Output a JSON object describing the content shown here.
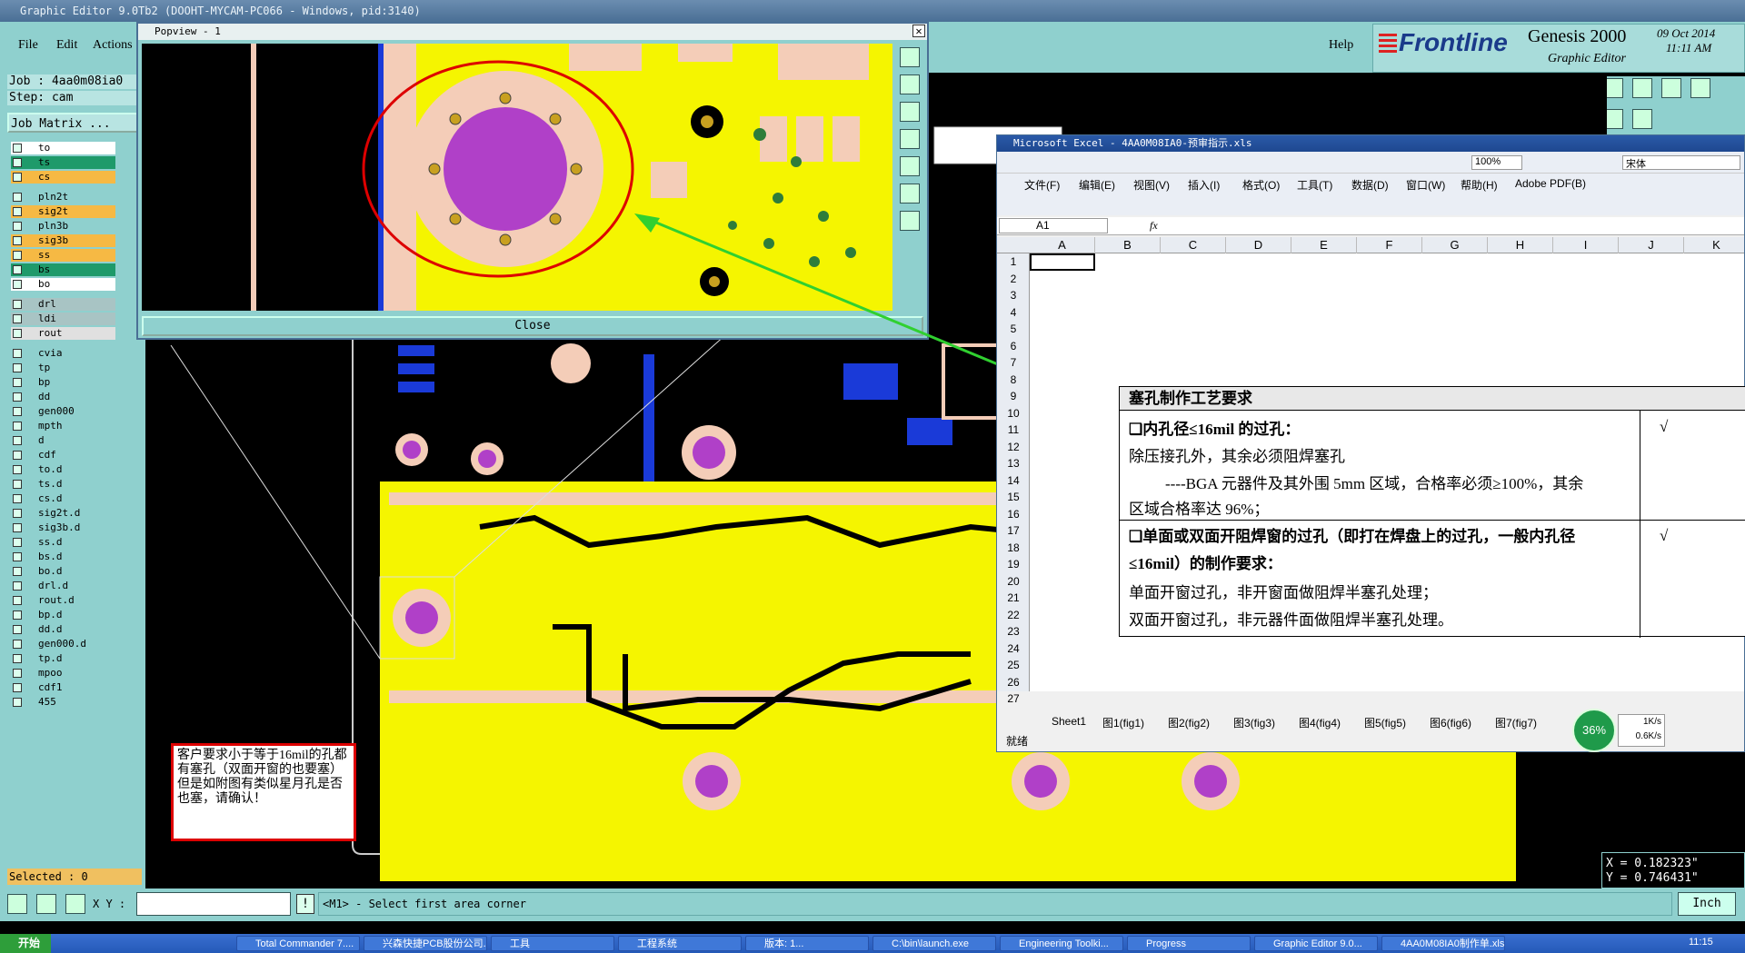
{
  "app": {
    "title": "Graphic Editor 9.0Tb2 (DOOHT-MYCAM-PC066 - Windows, pid:3140)"
  },
  "menu": {
    "file": "File",
    "edit": "Edit",
    "actions": "Actions",
    "help": "Help"
  },
  "brand": {
    "logo": "Frontline",
    "product": "Genesis 2000",
    "subtitle": "Graphic Editor",
    "date": "09 Oct 2014",
    "time": "11:11 AM"
  },
  "job": {
    "job_line": "Job : 4aa0m08ia0",
    "step_line": "Step: cam",
    "matrix_button": "Job Matrix ..."
  },
  "layers": [
    {
      "name": "to",
      "color": "#ffffff"
    },
    {
      "name": "ts",
      "color": "#1e9a6a"
    },
    {
      "name": "cs",
      "color": "#f6b944"
    },
    {
      "name": "pln2t",
      "color": "#8fd0ce"
    },
    {
      "name": "sig2t",
      "color": "#f6b944"
    },
    {
      "name": "pln3b",
      "color": "#8fd0ce"
    },
    {
      "name": "sig3b",
      "color": "#f6b944"
    },
    {
      "name": "ss",
      "color": "#f6b944"
    },
    {
      "name": "bs",
      "color": "#1e9a6a"
    },
    {
      "name": "bo",
      "color": "#ffffff"
    },
    {
      "name": "drl",
      "color": "#a8c4c4"
    },
    {
      "name": "ldi",
      "color": "#a8c4c4"
    },
    {
      "name": "rout",
      "color": "#e0e0e0"
    },
    {
      "name": "cvia",
      "color": "#8fd0ce"
    },
    {
      "name": "tp",
      "color": "#8fd0ce"
    },
    {
      "name": "bp",
      "color": "#8fd0ce"
    },
    {
      "name": "dd",
      "color": "#8fd0ce"
    },
    {
      "name": "gen000",
      "color": "#8fd0ce"
    },
    {
      "name": "mpth",
      "color": "#8fd0ce"
    },
    {
      "name": "d",
      "color": "#8fd0ce"
    },
    {
      "name": "cdf",
      "color": "#8fd0ce"
    },
    {
      "name": "to.d",
      "color": "#8fd0ce"
    },
    {
      "name": "ts.d",
      "color": "#8fd0ce"
    },
    {
      "name": "cs.d",
      "color": "#8fd0ce"
    },
    {
      "name": "sig2t.d",
      "color": "#8fd0ce"
    },
    {
      "name": "sig3b.d",
      "color": "#8fd0ce"
    },
    {
      "name": "ss.d",
      "color": "#8fd0ce"
    },
    {
      "name": "bs.d",
      "color": "#8fd0ce"
    },
    {
      "name": "bo.d",
      "color": "#8fd0ce"
    },
    {
      "name": "drl.d",
      "color": "#8fd0ce"
    },
    {
      "name": "rout.d",
      "color": "#8fd0ce"
    },
    {
      "name": "bp.d",
      "color": "#8fd0ce"
    },
    {
      "name": "dd.d",
      "color": "#8fd0ce"
    },
    {
      "name": "gen000.d",
      "color": "#8fd0ce"
    },
    {
      "name": "tp.d",
      "color": "#8fd0ce"
    },
    {
      "name": "mpoo",
      "color": "#8fd0ce"
    },
    {
      "name": "cdf1",
      "color": "#8fd0ce"
    },
    {
      "name": "455",
      "color": "#8fd0ce"
    }
  ],
  "selected": "Selected : 0",
  "popview": {
    "title": "Popview - 1",
    "close": "Close"
  },
  "note": "客户要求小于等于16mil的孔都有塞孔（双面开窗的也要塞）但是如附图有类似星月孔是否也塞，请确认！",
  "excel": {
    "title": "Microsoft Excel - 4AA0M08IA0-预审指示.xls",
    "zoom": "100%",
    "font": "宋体",
    "namebox": "A1",
    "fx": "fx",
    "menus": [
      "文件(F)",
      "编辑(E)",
      "视图(V)",
      "插入(I)",
      "格式(O)",
      "工具(T)",
      "数据(D)",
      "窗口(W)",
      "帮助(H)",
      "Adobe PDF(B)"
    ],
    "columns": [
      "A",
      "B",
      "C",
      "D",
      "E",
      "F",
      "G",
      "H",
      "I",
      "J",
      "K"
    ],
    "rows": [
      "1",
      "2",
      "3",
      "4",
      "5",
      "6",
      "7",
      "8",
      "9",
      "10",
      "11",
      "12",
      "13",
      "14",
      "15",
      "16",
      "17",
      "18",
      "19",
      "20",
      "21",
      "22",
      "23",
      "24",
      "25",
      "26",
      "27"
    ],
    "sheets": [
      "Sheet1",
      "图1(fig1)",
      "图2(fig2)",
      "图3(fig3)",
      "图4(fig4)",
      "图5(fig5)",
      "图6(fig6)",
      "图7(fig7)"
    ],
    "status": "就绪",
    "box": {
      "header": "塞孔制作工艺要求",
      "item1_title": "❑内孔径≤16mil 的过孔：",
      "item1_line1": "除压接孔外，其余必须阻焊塞孔",
      "item1_line2": "----BGA 元器件及其外围 5mm 区域，合格率必须≥100%，其余",
      "item1_line3": "区域合格率达 96%；",
      "item2_title": "❑单面或双面开阻焊窗的过孔（即打在焊盘上的过孔，一般内孔径",
      "item2_title2": "≤16mil）的制作要求：",
      "item2_line1": "单面开窗过孔，非开窗面做阻焊半塞孔处理；",
      "item2_line2": "双面开窗过孔，非元器件面做阻焊半塞孔处理。",
      "check": "√"
    }
  },
  "net": {
    "percent": "36%",
    "up": "1K/s",
    "down": "0.6K/s"
  },
  "coords": {
    "x": "X = 0.182323\"",
    "y": "Y = 0.746431\""
  },
  "cmd": {
    "xy_label": "X Y :",
    "prompt": "<M1> - Select first area corner",
    "unit": "Inch"
  },
  "taskbar": {
    "start": "开始",
    "clock": "11:15",
    "tasks": [
      "Total Commander 7....",
      "兴森快捷PCB股份公司...",
      "工具",
      "工程系统",
      "版本: 1...",
      "C:\\bin\\launch.exe",
      "Engineering Toolki...",
      "Progress",
      "Graphic Editor 9.0...",
      "4AA0M08IA0制作单.xls"
    ]
  }
}
